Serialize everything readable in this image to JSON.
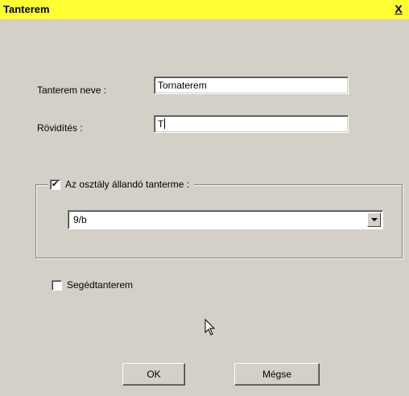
{
  "window": {
    "title": "Tanterem",
    "close_label": "X"
  },
  "form": {
    "name_label": "Tanterem neve :",
    "name_value": "Tornaterem",
    "abbr_label": "Rövidítés :",
    "abbr_value": "T"
  },
  "group": {
    "checkbox_label": "Az osztály állandó tanterme :",
    "checked": true,
    "class_select_value": "9/b"
  },
  "aux": {
    "label": "Segédtanterem",
    "checked": false
  },
  "buttons": {
    "ok": "OK",
    "cancel": "Mégse"
  },
  "icons": {
    "close": "close-icon",
    "dropdown": "chevron-down-icon",
    "cursor": "mouse-pointer-icon"
  },
  "colors": {
    "titlebar": "#ffff33",
    "dialog": "#d4d0c8"
  }
}
